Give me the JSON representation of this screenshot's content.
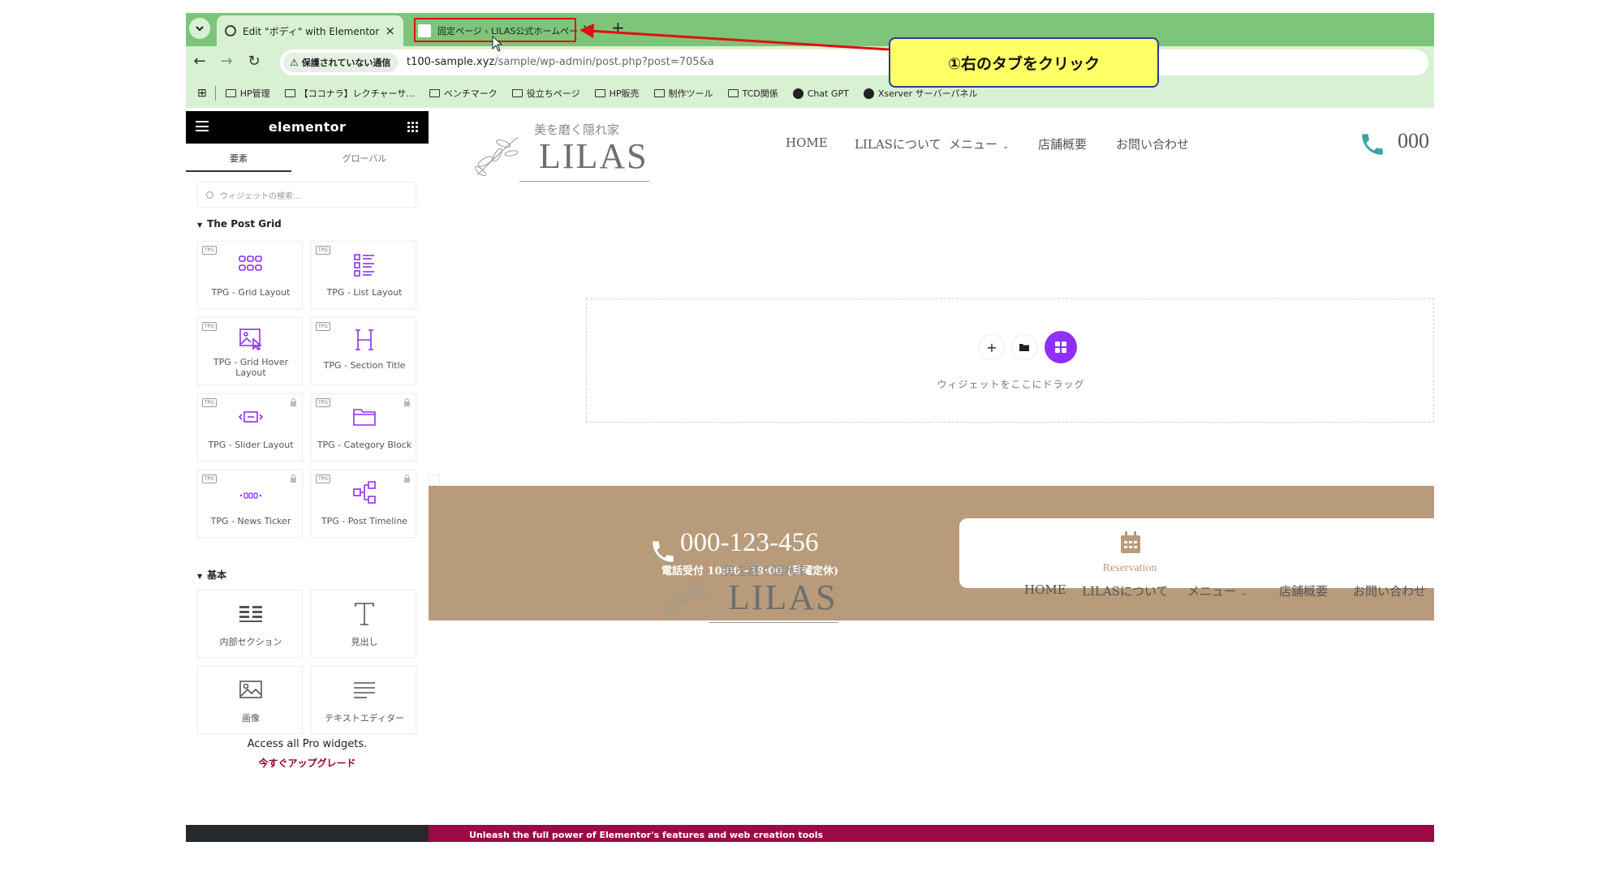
{
  "browser": {
    "active_tab_title": "Edit \"ボディ\" with Elementor",
    "inactive_tab_title": "固定ページ ‹ LILAS公式ホームペー",
    "security_label": "保護されていない通信",
    "url_host": "t100-sample.xyz",
    "url_path": "/sample/wp-admin/post.php?post=705&a",
    "bookmarks": [
      "HP管理",
      "【ココナラ】レクチャーサ...",
      "ベンチマーク",
      "役立ちページ",
      "HP販売",
      "制作ツール",
      "TCD関係",
      "Chat GPT",
      "Xserver サーバーパネル"
    ]
  },
  "annotation": {
    "text": "①右のタブをクリック",
    "highlight_color": "#e01010",
    "callout_bg": "#ffff66"
  },
  "panel": {
    "logo": "elementor",
    "tabs": [
      "要素",
      "グローバル"
    ],
    "search_placeholder": "ウィジェットの検索...",
    "section1": "The Post Grid",
    "badge": "TPG",
    "widgets1": [
      {
        "label": "TPG - Grid Layout",
        "icon": "grid-layout-icon",
        "locked": false
      },
      {
        "label": "TPG - List Layout",
        "icon": "list-layout-icon",
        "locked": false
      },
      {
        "label": "TPG - Grid Hover Layout",
        "icon": "image-hover-icon",
        "locked": false
      },
      {
        "label": "TPG - Section Title",
        "icon": "heading-h-icon",
        "locked": false
      },
      {
        "label": "TPG - Slider Layout",
        "icon": "slider-icon",
        "locked": true
      },
      {
        "label": "TPG - Category Block",
        "icon": "folder-icon",
        "locked": true
      },
      {
        "label": "TPG - News Ticker",
        "icon": "ticker-icon",
        "locked": true
      },
      {
        "label": "TPG - Post Timeline",
        "icon": "timeline-icon",
        "locked": true
      }
    ],
    "section2": "基本",
    "widgets2": [
      {
        "label": "内部セクション",
        "icon": "inner-section-icon"
      },
      {
        "label": "見出し",
        "icon": "heading-t-icon"
      },
      {
        "label": "画像",
        "icon": "image-icon"
      },
      {
        "label": "テキストエディター",
        "icon": "text-editor-icon"
      }
    ],
    "pro_text": "Access all Pro widgets.",
    "pro_link": "今すぐアップグレード",
    "accent": "#93003c"
  },
  "site": {
    "logo_tagline": "美を磨く隠れ家",
    "logo_name": "LILAS",
    "nav": [
      "HOME",
      "LILASについて",
      "メニュー",
      "店舗概要",
      "お問い合わせ"
    ],
    "header_phone": "000",
    "dropzone_text": "ウィジェットをここにドラッグ",
    "band_phone": "000-123-456",
    "band_hours": "電話受付 10:00~19:00 (月曜定休)",
    "reservation_label": "Reservation",
    "band_color": "#b89b7a",
    "phone_icon_color": "#3aa3a8",
    "kit_color": "#8f2ffa"
  },
  "promo": {
    "text": "Unleash the full power of Elementor's features and web creation tools",
    "bar_color": "#9b0b45"
  }
}
